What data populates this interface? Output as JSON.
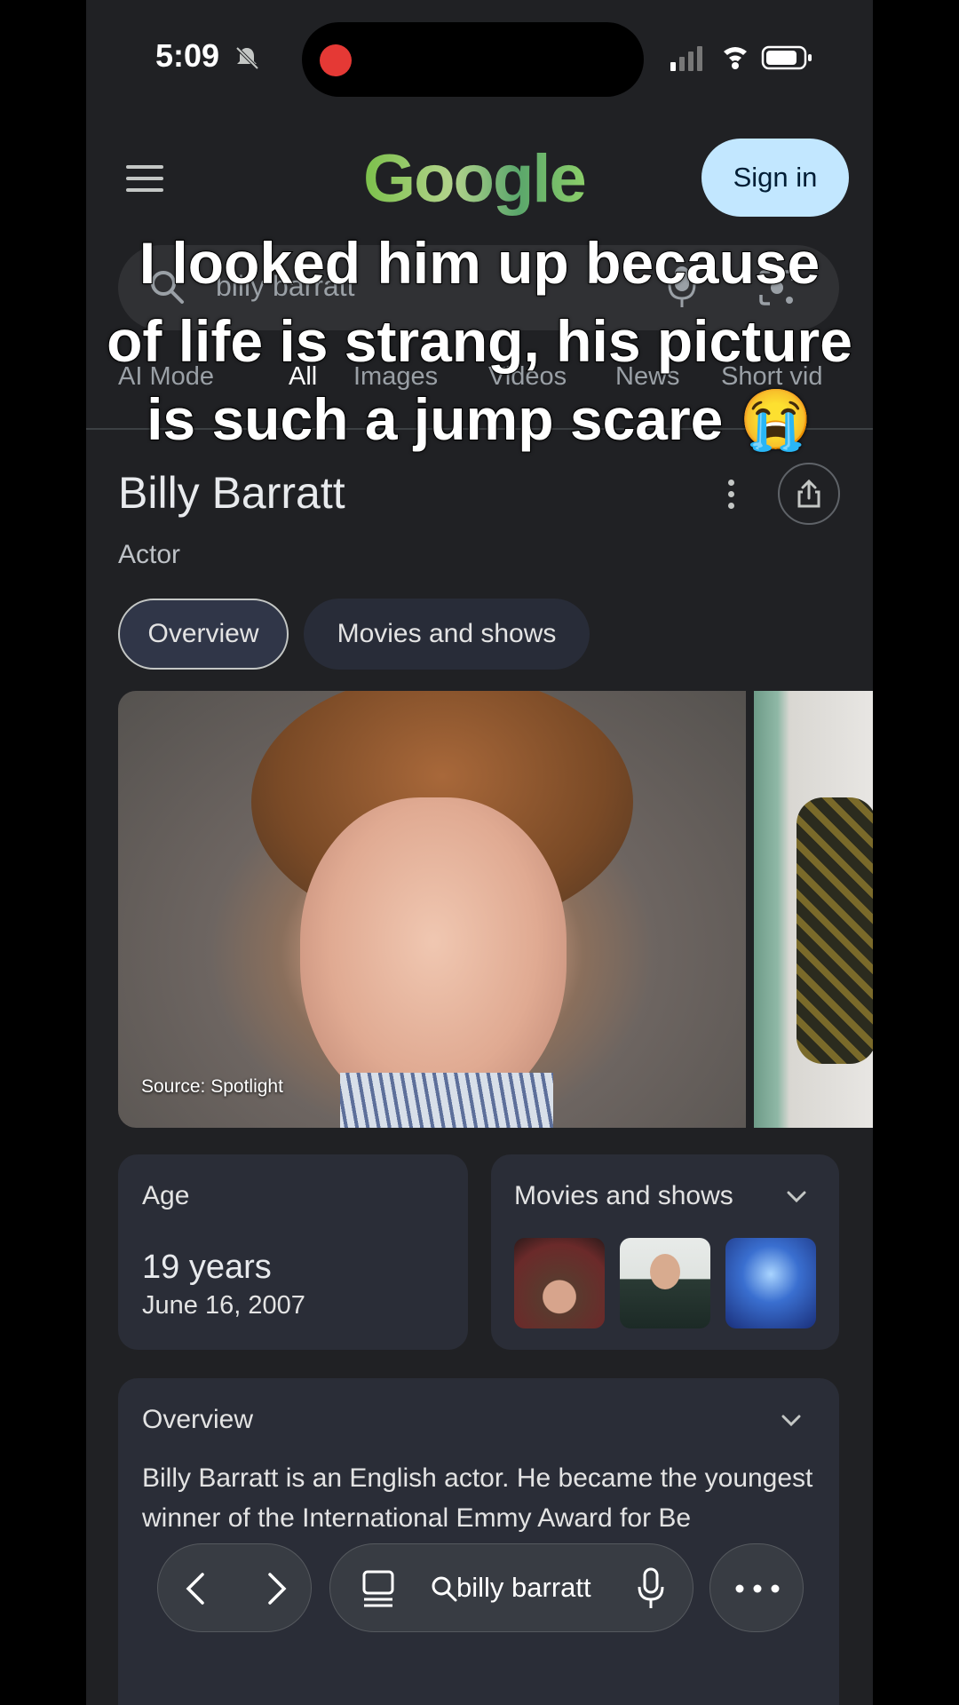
{
  "status": {
    "time": "5:09"
  },
  "header": {
    "logo": "Google",
    "signin_label": "Sign in"
  },
  "search": {
    "query": "billy barratt"
  },
  "tabs": [
    "AI Mode",
    "All",
    "Images",
    "Videos",
    "News",
    "Short vid"
  ],
  "active_tab": "All",
  "caption": {
    "line1": "I looked him up because",
    "line2": "of life is strang, his picture",
    "line3": "is such a jump scare 😭"
  },
  "panel": {
    "title": "Billy Barratt",
    "subtitle": "Actor",
    "chips": [
      "Overview",
      "Movies and shows"
    ],
    "photo_source": "Source: Spotlight",
    "age_label": "Age",
    "age_value": "19 years",
    "birth_date": "June 16, 2007",
    "movies_label": "Movies and shows",
    "overview_label": "Overview",
    "overview_text": "Billy Barratt is an English actor. He became the youngest winner of the International Emmy Award for Be"
  },
  "bottom_nav": {
    "query": "billy barratt"
  },
  "colors": {
    "accent": "#c2e7ff",
    "background": "#202124",
    "card": "#2a2d37"
  },
  "icons": [
    "bell-mute-icon",
    "signal-icon",
    "wifi-icon",
    "battery-icon",
    "menu-icon",
    "search-icon",
    "mic-icon",
    "lens-icon",
    "more-vert-icon",
    "share-icon",
    "chevron-down-icon",
    "back-icon",
    "forward-icon",
    "tabs-icon",
    "more-horiz-icon"
  ]
}
